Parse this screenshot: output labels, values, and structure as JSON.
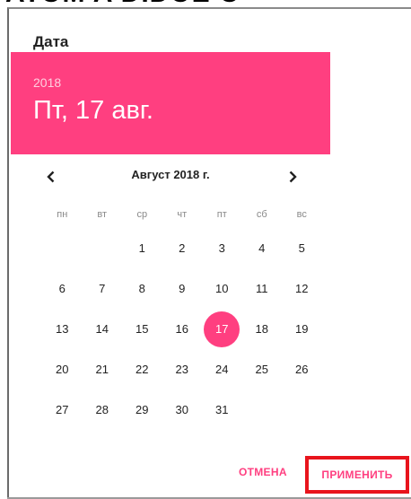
{
  "top_text": "ATOM A DIDOE O",
  "dialog": {
    "title": "Дата",
    "header": {
      "year": "2018",
      "selected_date": "Пт, 17 авг."
    },
    "navigation": {
      "prev_icon": "chevron-left-icon",
      "next_icon": "chevron-right-icon",
      "prev_glyph": "‹",
      "next_glyph": "›",
      "month_label": "Август 2018 г."
    },
    "weekdays": [
      "пн",
      "вт",
      "ср",
      "чт",
      "пт",
      "сб",
      "вс"
    ],
    "weeks": [
      [
        "",
        "",
        "1",
        "2",
        "3",
        "4",
        "5"
      ],
      [
        "6",
        "7",
        "8",
        "9",
        "10",
        "11",
        "12"
      ],
      [
        "13",
        "14",
        "15",
        "16",
        "17",
        "18",
        "19"
      ],
      [
        "20",
        "21",
        "22",
        "23",
        "24",
        "25",
        "26"
      ],
      [
        "27",
        "28",
        "29",
        "30",
        "31",
        "",
        ""
      ]
    ],
    "selected_day": "17",
    "actions": {
      "cancel_label": "ОТМЕНА",
      "apply_label": "ПРИМЕНИТЬ"
    }
  },
  "colors": {
    "accent": "#ff3f80",
    "highlight_box": "#e8141c",
    "text": "#222222",
    "weekday_text": "#8a8a8a"
  }
}
